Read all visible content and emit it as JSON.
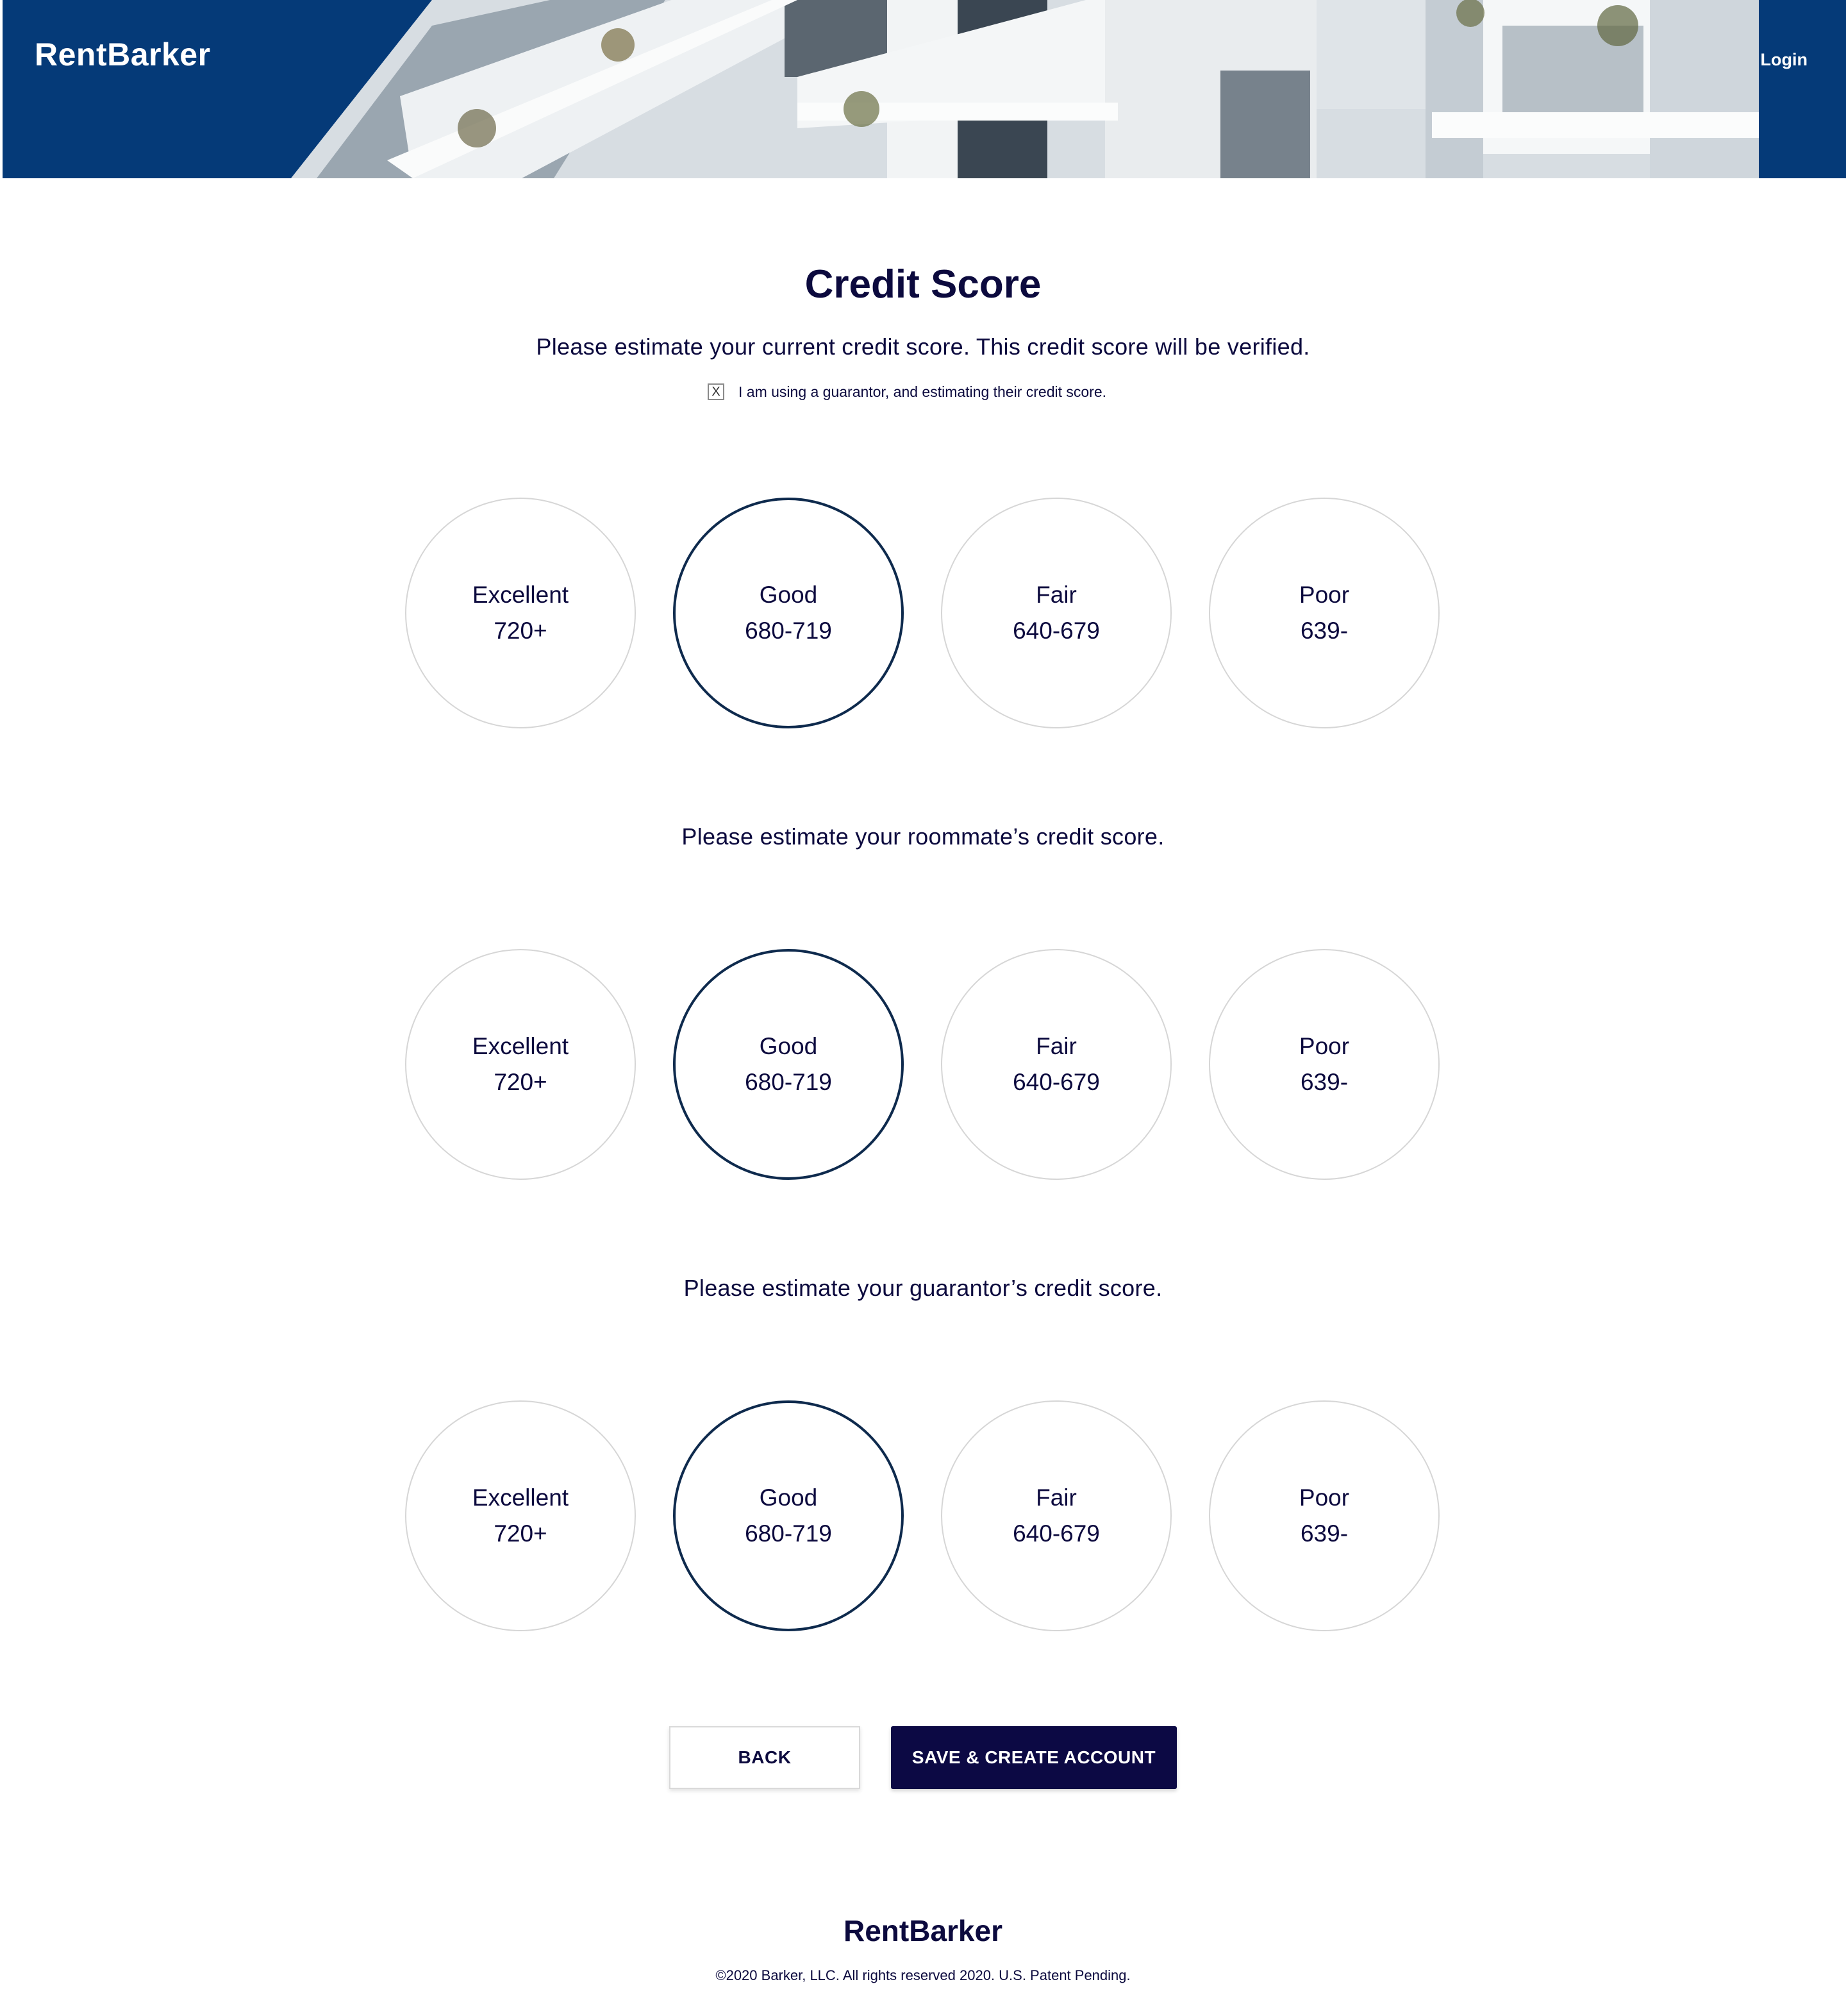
{
  "header": {
    "logo": "RentBarker",
    "login_label": "Login"
  },
  "main": {
    "title": "Credit Score",
    "subtitle": "Please estimate your current credit score. This credit score will be verified.",
    "guarantor_checkbox": {
      "mark": "X",
      "label": "I am using a guarantor, and estimating their credit score."
    },
    "sections": [
      {
        "label": "",
        "options": [
          {
            "label": "Excellent",
            "range": "720+"
          },
          {
            "label": "Good",
            "range": "680-719"
          },
          {
            "label": "Fair",
            "range": "640-679"
          },
          {
            "label": "Poor",
            "range": "639-"
          }
        ],
        "selected": "Good"
      },
      {
        "label": "Please estimate your roommate’s credit score.",
        "options": [
          {
            "label": "Excellent",
            "range": "720+"
          },
          {
            "label": "Good",
            "range": "680-719"
          },
          {
            "label": "Fair",
            "range": "640-679"
          },
          {
            "label": "Poor",
            "range": "639-"
          }
        ],
        "selected": "Good"
      },
      {
        "label": "Please estimate your guarantor’s credit score.",
        "options": [
          {
            "label": "Excellent",
            "range": "720+"
          },
          {
            "label": "Good",
            "range": "680-719"
          },
          {
            "label": "Fair",
            "range": "640-679"
          },
          {
            "label": "Poor",
            "range": "639-"
          }
        ],
        "selected": "Good"
      }
    ],
    "buttons": {
      "back_label": "BACK",
      "save_label": "SAVE & CREATE ACCOUNT"
    }
  },
  "footer": {
    "logo": "RentBarker",
    "copyright": "©2020 Barker, LLC. All rights reserved 2020. U.S. Patent Pending."
  },
  "colors": {
    "header_bg": "#053a78",
    "text_navy": "#0c0a3e",
    "primary_button": "#0c0944",
    "selected_border": "#0e2a4d"
  }
}
